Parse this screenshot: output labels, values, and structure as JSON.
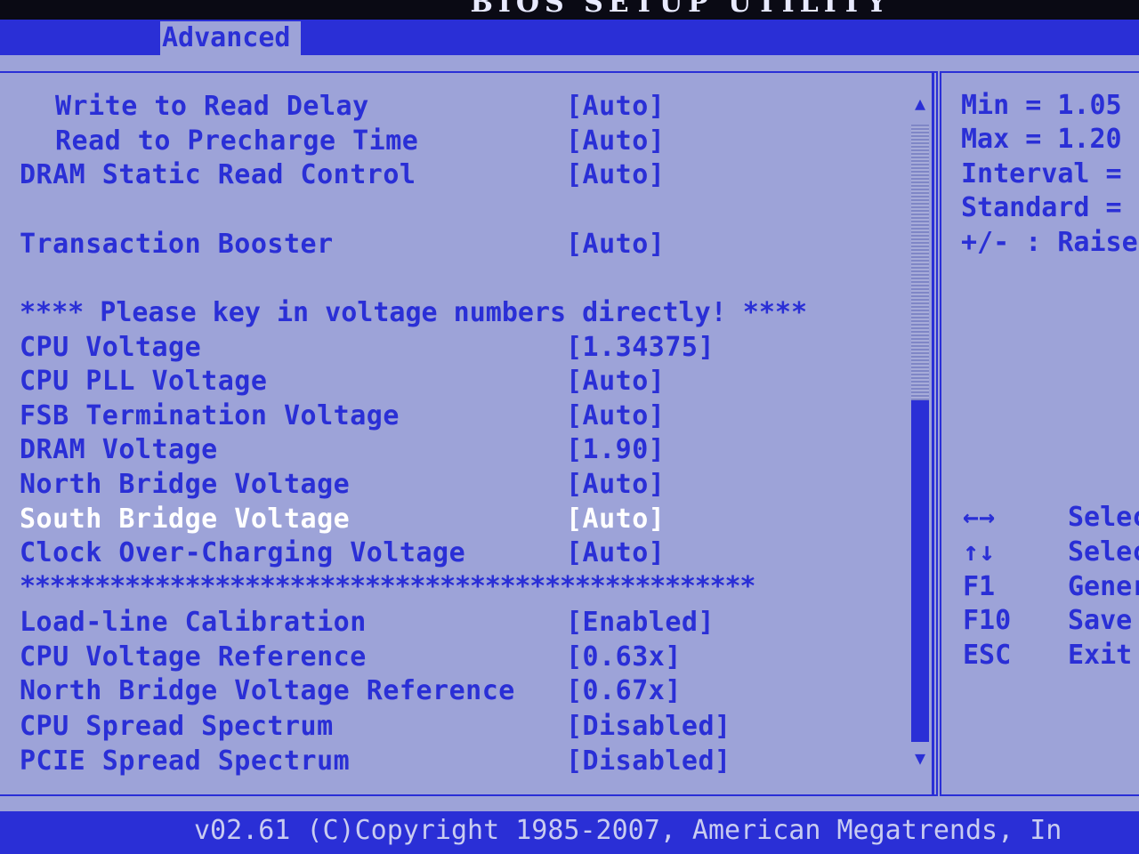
{
  "window": {
    "title": "BIOS SETUP UTILITY"
  },
  "tabs": [
    {
      "label": "Advanced"
    }
  ],
  "settings": [
    {
      "label": "  Write to Read Delay",
      "value": "[Auto]"
    },
    {
      "label": "  Read to Precharge Time",
      "value": "[Auto]"
    },
    {
      "label": "DRAM Static Read Control",
      "value": "[Auto]"
    },
    {
      "label": "Transaction Booster",
      "value": "[Auto]"
    },
    {
      "label": "**** Please key in voltage numbers directly! ****"
    },
    {
      "label": "CPU Voltage",
      "value": "[1.34375]"
    },
    {
      "label": "CPU PLL Voltage",
      "value": "[Auto]"
    },
    {
      "label": "FSB Termination Voltage",
      "value": "[Auto]"
    },
    {
      "label": "DRAM Voltage",
      "value": "[1.90]"
    },
    {
      "label": "North Bridge Voltage",
      "value": "[Auto]"
    },
    {
      "label": "South Bridge Voltage",
      "value": "[Auto]",
      "selected": true
    },
    {
      "label": "Clock Over-Charging Voltage",
      "value": "[Auto]"
    },
    {
      "label": "*************************************************"
    },
    {
      "label": "Load-line Calibration",
      "value": "[Enabled]"
    },
    {
      "label": "CPU Voltage Reference",
      "value": "[0.63x]"
    },
    {
      "label": "North Bridge Voltage Reference",
      "value": "[0.67x]"
    },
    {
      "label": "CPU Spread Spectrum",
      "value": "[Disabled]"
    },
    {
      "label": "PCIE Spread Spectrum",
      "value": "[Disabled]"
    }
  ],
  "help": {
    "lines": [
      "Min = 1.05",
      "Max = 1.20",
      "Interval =",
      "Standard =",
      "+/- : Raise"
    ],
    "keys": [
      {
        "key": "←→",
        "desc": "Select"
      },
      {
        "key": "↑↓",
        "desc": "Select"
      },
      {
        "key": "F1",
        "desc": "General"
      },
      {
        "key": "F10",
        "desc": "Save"
      },
      {
        "key": "ESC",
        "desc": "Exit"
      }
    ]
  },
  "scrollbar": {
    "up_icon": "arrow-up",
    "down_icon": "arrow-down"
  },
  "footer": {
    "text": "v02.61 (C)Copyright 1985-2007, American Megatrends, In"
  },
  "colors": {
    "background": "#9da3d8",
    "accent": "#2a2fd6",
    "selected_text": "#ffffff",
    "title_bar": "#0a0a14"
  }
}
